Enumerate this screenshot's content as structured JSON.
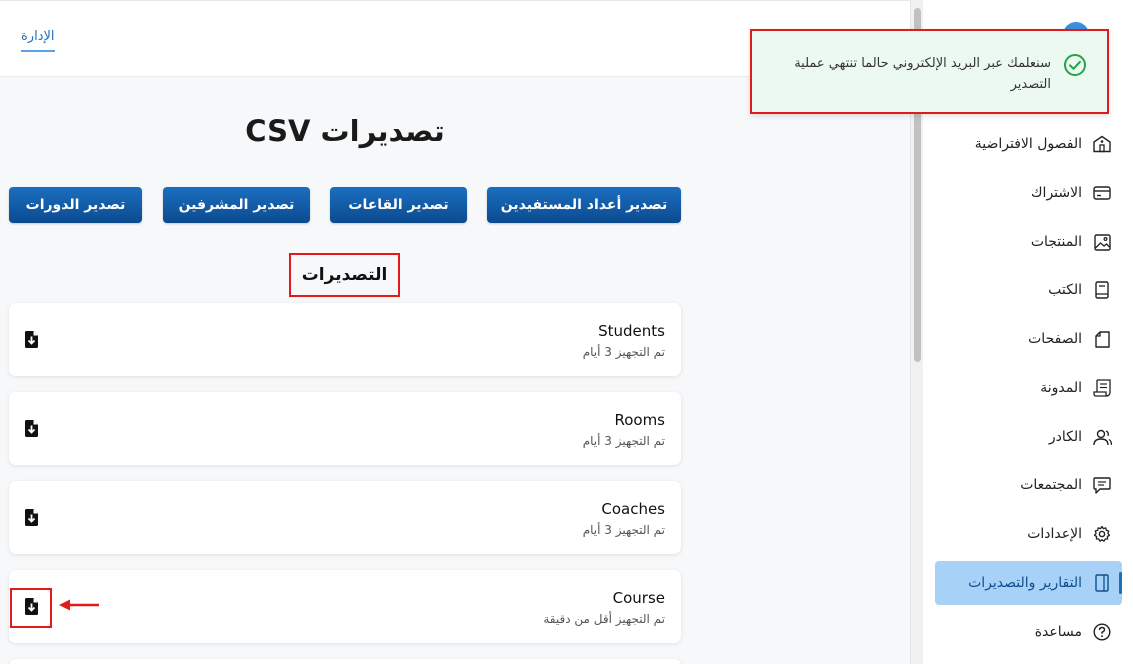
{
  "header": {
    "admin_tab": "الإدارة"
  },
  "main": {
    "title": "تصديرات CSV",
    "buttons": [
      {
        "label": "تصدير أعداد المستفيدين"
      },
      {
        "label": "تصدير القاعات"
      },
      {
        "label": "تصدير المشرفين"
      },
      {
        "label": "تصدير الدورات"
      }
    ],
    "exports_title": "التصديرات",
    "exports": [
      {
        "name": "Students",
        "status": "تم التجهيز 3 أيام"
      },
      {
        "name": "Rooms",
        "status": "تم التجهيز 3 أيام"
      },
      {
        "name": "Coaches",
        "status": "تم التجهيز 3 أيام"
      },
      {
        "name": "Course",
        "status": "تم التجهيز أقل من دقيقة"
      }
    ]
  },
  "sidebar": {
    "items": [
      {
        "label": "الفصول الافتراضية",
        "icon": "classroom-icon"
      },
      {
        "label": "الاشتراك",
        "icon": "credit-card-icon"
      },
      {
        "label": "المنتجات",
        "icon": "image-icon"
      },
      {
        "label": "الكتب",
        "icon": "book-icon"
      },
      {
        "label": "الصفحات",
        "icon": "page-icon"
      },
      {
        "label": "المدونة",
        "icon": "scroll-icon"
      },
      {
        "label": "الكادر",
        "icon": "users-icon"
      },
      {
        "label": "المجتمعات",
        "icon": "chat-icon"
      },
      {
        "label": "الإعدادات",
        "icon": "gear-icon"
      },
      {
        "label": "التقارير والتصديرات",
        "icon": "report-icon",
        "active": true
      },
      {
        "label": "مساعدة",
        "icon": "help-icon"
      }
    ]
  },
  "toast": {
    "message": "سنعلمك عبر البريد الإلكتروني حالما تنتهي عملية التصدير"
  },
  "colors": {
    "primary": "#0b4a8f",
    "active_bg": "#a8d1f8",
    "toast_bg": "#ecf9f0",
    "success": "#22a447",
    "highlight": "#e01b1b"
  }
}
